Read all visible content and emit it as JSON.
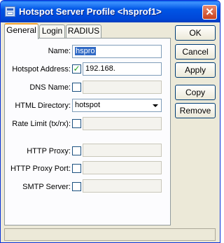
{
  "window": {
    "title": "Hotspot Server Profile <hsprof1>",
    "close_glyph": "✕"
  },
  "tabs": [
    {
      "label": "General",
      "active": true
    },
    {
      "label": "Login",
      "active": false
    },
    {
      "label": "RADIUS",
      "active": false
    }
  ],
  "form": {
    "name": {
      "label": "Name:",
      "value": "hspro"
    },
    "hotspot_address": {
      "label": "Hotspot Address:",
      "checked": true,
      "check_glyph": "✓",
      "value": "192.168."
    },
    "dns_name": {
      "label": "DNS Name:",
      "checked": false,
      "value": ""
    },
    "html_directory": {
      "label": "HTML Directory:",
      "value": "hotspot"
    },
    "rate_limit": {
      "label": "Rate Limit (tx/rx):",
      "checked": false,
      "value": ""
    },
    "http_proxy": {
      "label": "HTTP Proxy:",
      "checked": false,
      "value": ""
    },
    "http_proxy_port": {
      "label": "HTTP Proxy Port:",
      "checked": false,
      "value": ""
    },
    "smtp_server": {
      "label": "SMTP Server:",
      "checked": false,
      "value": ""
    }
  },
  "buttons": {
    "ok": "OK",
    "cancel": "Cancel",
    "apply": "Apply",
    "copy": "Copy",
    "remove": "Remove"
  },
  "colors": {
    "titlebar": "#0055e5",
    "selection": "#316ac5",
    "checkmark": "#21a121",
    "close": "#c8401e"
  },
  "icons": {
    "app": "window-app-icon",
    "close": "close-icon",
    "dropdown": "chevron-down-icon"
  }
}
